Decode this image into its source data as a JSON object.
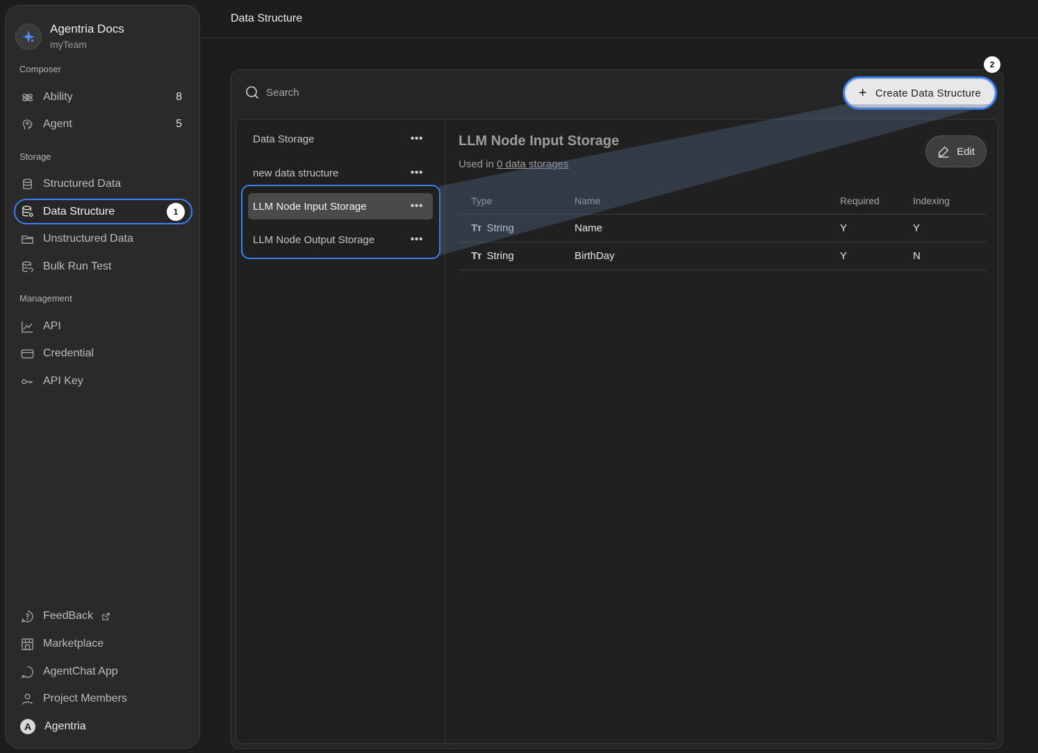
{
  "brand": {
    "title": "Agentria Docs",
    "team": "myTeam"
  },
  "sidebar": {
    "sections": {
      "composer": "Composer",
      "storage": "Storage",
      "management": "Management"
    },
    "items": [
      {
        "label": "Ability",
        "count": "8"
      },
      {
        "label": "Agent",
        "count": "5"
      },
      {
        "label": "Structured Data"
      },
      {
        "label": "Data Structure",
        "badge": "1"
      },
      {
        "label": "Unstructured Data"
      },
      {
        "label": "Bulk Run Test"
      },
      {
        "label": "API"
      },
      {
        "label": "Credential"
      },
      {
        "label": "API Key"
      }
    ],
    "footer": [
      {
        "label": "FeedBack"
      },
      {
        "label": "Marketplace"
      },
      {
        "label": "AgentChat App"
      },
      {
        "label": "Project Members"
      },
      {
        "label": "Agentria",
        "avatar": "A"
      }
    ]
  },
  "header": {
    "title": "Data Structure"
  },
  "search": {
    "placeholder": "Search"
  },
  "create_button": {
    "label": "Create Data Structure",
    "badge": "2"
  },
  "list": [
    {
      "label": "Data Storage",
      "more": "•••"
    },
    {
      "label": "new data structure",
      "more": "•••"
    },
    {
      "label": "LLM Node Input Storage",
      "more": "•••"
    },
    {
      "label": "LLM Node Output Storage",
      "more": "•••"
    }
  ],
  "detail": {
    "title": "LLM Node Input Storage",
    "used_in_prefix": "Used in ",
    "used_in_link": "0 data storages",
    "edit_label": "Edit",
    "columns": [
      "Type",
      "Name",
      "Required",
      "Indexing"
    ],
    "rows": [
      {
        "type": "String",
        "name": "Name",
        "required": "Y",
        "indexing": "Y"
      },
      {
        "type": "String",
        "name": "BirthDay",
        "required": "Y",
        "indexing": "N"
      }
    ]
  },
  "colors": {
    "accent": "#3b82f6",
    "bg": "#1d1d1d",
    "panel": "#252525"
  }
}
